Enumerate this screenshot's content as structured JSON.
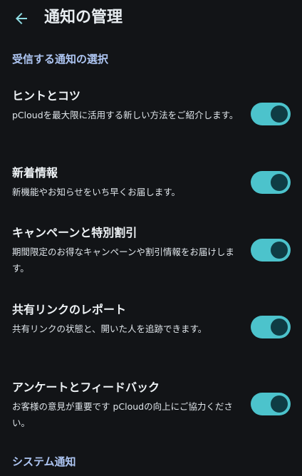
{
  "header": {
    "title": "通知の管理"
  },
  "sections": [
    {
      "title": "受信する通知の選択"
    },
    {
      "title": "システム通知"
    }
  ],
  "settings": [
    {
      "title": "ヒントとコツ",
      "description": "pCloudを最大限に活用する新しい方法をご紹介します。",
      "enabled": true
    },
    {
      "title": "新着情報",
      "description": "新機能やお知らせをいち早くお届します。",
      "enabled": true
    },
    {
      "title": "キャンペーンと特別割引",
      "description": "期間限定のお得なキャンペーンや割引情報をお届けします。",
      "enabled": true
    },
    {
      "title": "共有リンクのレポート",
      "description": "共有リンクの状態と、開いた人を追跡できます。",
      "enabled": true
    },
    {
      "title": "アンケートとフィードバック",
      "description": "お客様の意見が重要です pCloudの向上にご協力ください。",
      "enabled": true
    }
  ],
  "colors": {
    "background": "#121417",
    "accent": "#4cc3cc",
    "section_header": "#aec6f3"
  }
}
